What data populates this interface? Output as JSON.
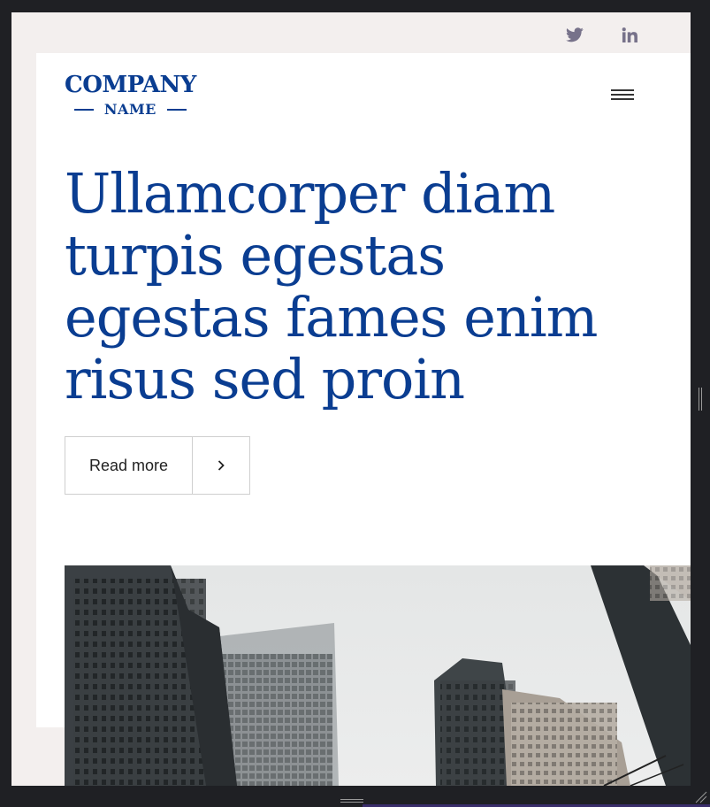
{
  "social": {
    "icons": [
      "twitter-icon",
      "linkedin-icon"
    ],
    "color": "#77728a"
  },
  "logo": {
    "top": "COMPANY",
    "bottom": "NAME",
    "color": "#0a3d91"
  },
  "menu": {
    "icon": "hamburger-menu-icon"
  },
  "hero": {
    "headline": "Ullamcorper diam turpis egestas egestas fames enim risus sed proin",
    "button_label": "Read more",
    "button_icon": "chevron-right-icon"
  },
  "image": {
    "subject": "city-buildings-photo"
  },
  "colors": {
    "accent": "#0a3d91",
    "page_bg": "#f3efee",
    "card_bg": "#ffffff",
    "frame": "#1f2024"
  }
}
